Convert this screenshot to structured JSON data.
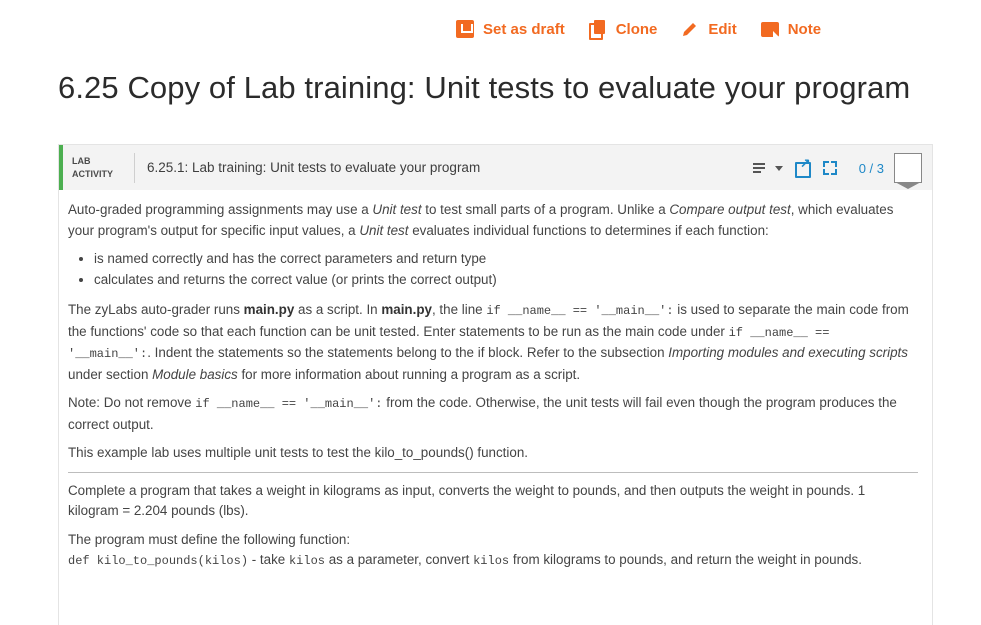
{
  "toolbar": {
    "draft_label": "Set as draft",
    "clone_label": "Clone",
    "edit_label": "Edit",
    "note_label": "Note"
  },
  "page_title": "6.25 Copy of Lab training: Unit tests to evaluate your program",
  "lab": {
    "type_line1": "LAB",
    "type_line2": "ACTIVITY",
    "name": "6.25.1: Lab training: Unit tests to evaluate your program",
    "score": "0 / 3",
    "accent_color": "#4caf50"
  },
  "content": {
    "p1": {
      "a": "Auto-graded programming assignments may use a ",
      "b": "Unit test",
      "c": " to test small parts of a program. Unlike a ",
      "d": "Compare output test",
      "e": ", which evaluates your program's output for specific input values, a ",
      "f": "Unit test",
      "g": " evaluates individual functions to determines if each function:"
    },
    "bullets": [
      "is named correctly and has the correct parameters and return type",
      "calculates and returns the correct value (or prints the correct output)"
    ],
    "p2": {
      "a": "The zyLabs auto-grader runs ",
      "b": "main.py",
      "c": " as a script. In ",
      "d": "main.py",
      "e": ", the line ",
      "f": "if __name__ == '__main__':",
      "g": " is used to separate the main code from the functions' code so that each function can be unit tested. Enter statements to be run as the main code under ",
      "h": "if __name__ == '__main__':",
      "i": ". Indent the statements so the statements belong to the if block. Refer to the subsection ",
      "j": "Importing modules and executing scripts",
      "k": " under section ",
      "l": "Module basics",
      "m": " for more information about running a program as a script."
    },
    "p3": {
      "a": "Note: Do not remove ",
      "b": "if __name__ == '__main__':",
      "c": " from the code. Otherwise, the unit tests will fail even though the program produces the correct output."
    },
    "p4": "This example lab uses multiple unit tests to test the kilo_to_pounds() function.",
    "p5": "Complete a program that takes a weight in kilograms as input, converts the weight to pounds, and then outputs the weight in pounds. 1 kilogram = 2.204 pounds (lbs).",
    "p6": {
      "a": "The program must define the following function:",
      "b": "def kilo_to_pounds(kilos)",
      "c": " - take ",
      "d": "kilos",
      "e": " as a parameter, convert ",
      "f": "kilos",
      "g": " from kilograms to pounds, and return the weight in pounds."
    }
  }
}
